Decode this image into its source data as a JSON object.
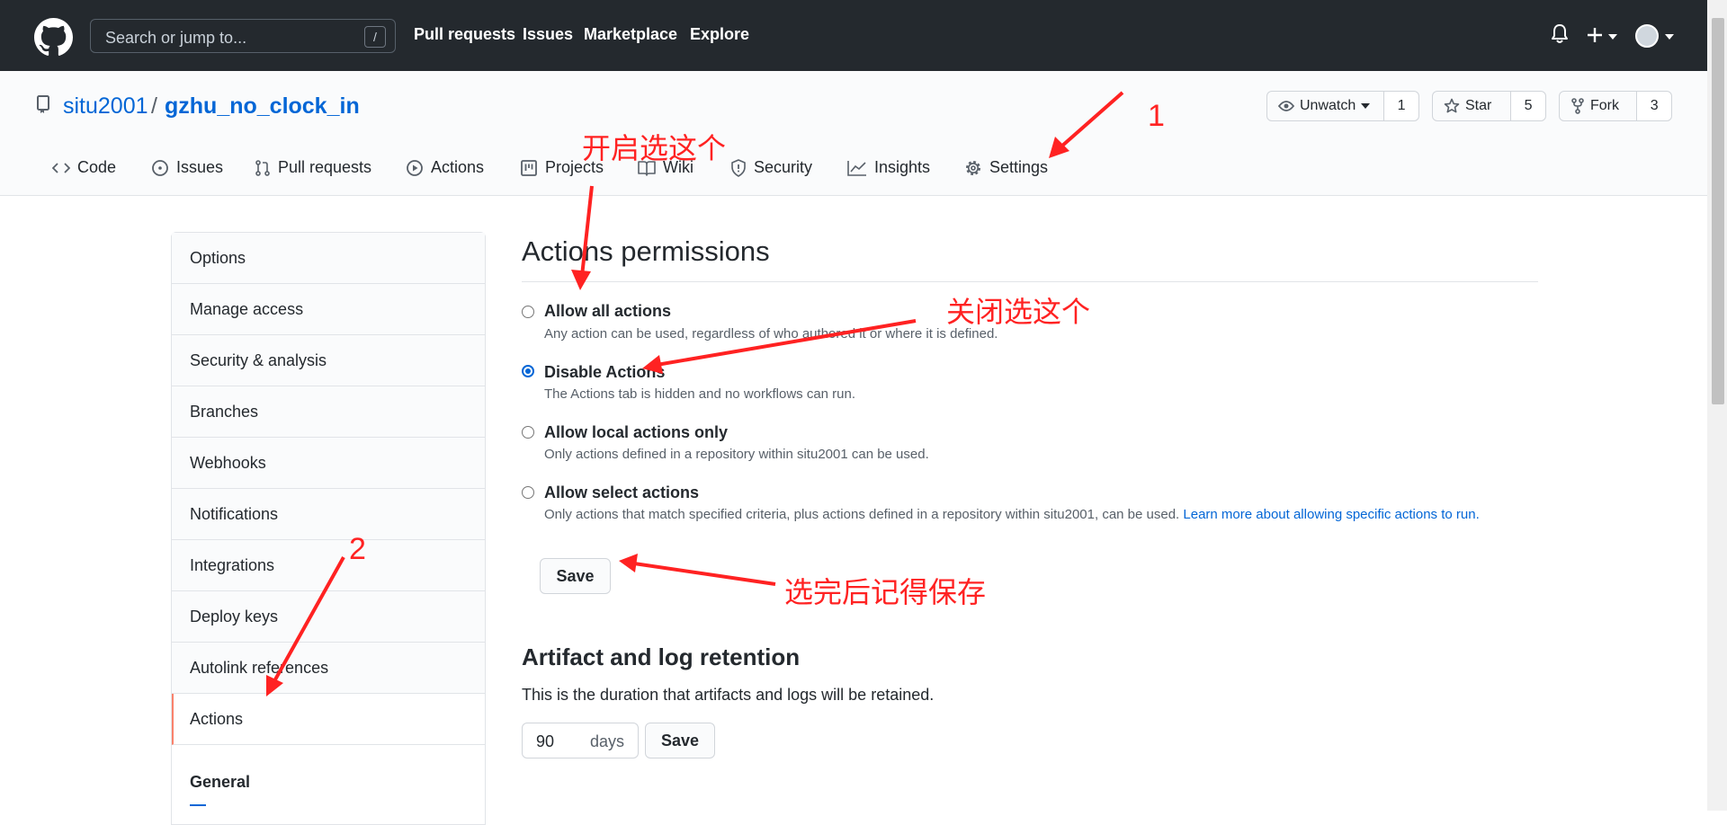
{
  "header": {
    "search_placeholder": "Search or jump to...",
    "search_shortcut": "/",
    "nav": [
      "Pull requests",
      "Issues",
      "Marketplace",
      "Explore"
    ]
  },
  "repo": {
    "owner": "situ2001",
    "separator": "/",
    "name": "gzhu_no_clock_in",
    "watch_label": "Unwatch",
    "watch_count": "1",
    "star_label": "Star",
    "star_count": "5",
    "fork_label": "Fork",
    "fork_count": "3"
  },
  "tabs": [
    "Code",
    "Issues",
    "Pull requests",
    "Actions",
    "Projects",
    "Wiki",
    "Security",
    "Insights",
    "Settings"
  ],
  "sidebar": {
    "items": [
      "Options",
      "Manage access",
      "Security & analysis",
      "Branches",
      "Webhooks",
      "Notifications",
      "Integrations",
      "Deploy keys",
      "Autolink references",
      "Actions"
    ],
    "active": "Actions",
    "section_heading": "General"
  },
  "permissions": {
    "title": "Actions permissions",
    "options": [
      {
        "label": "Allow all actions",
        "note": "Any action can be used, regardless of who authored it or where it is defined.",
        "checked": false
      },
      {
        "label": "Disable Actions",
        "note": "The Actions tab is hidden and no workflows can run.",
        "checked": true
      },
      {
        "label": "Allow local actions only",
        "note": "Only actions defined in a repository within situ2001 can be used.",
        "checked": false
      },
      {
        "label": "Allow select actions",
        "note": "Only actions that match specified criteria, plus actions defined in a repository within situ2001, can be used.",
        "checked": false
      }
    ],
    "learn_more": "Learn more about allowing specific actions to run.",
    "save_label": "Save"
  },
  "retention": {
    "title": "Artifact and log retention",
    "description": "This is the duration that artifacts and logs will be retained.",
    "days_value": "90",
    "days_unit": "days",
    "save_label": "Save"
  },
  "annotations": {
    "enable": "开启选这个",
    "disable": "关闭选这个",
    "save_hint": "选完后记得保存",
    "step1": "1",
    "step2": "2"
  },
  "colors": {
    "header_bg": "#24292e",
    "link": "#0366d6",
    "annotation": "#ff2222",
    "active_tab_border": "#f9826c"
  }
}
